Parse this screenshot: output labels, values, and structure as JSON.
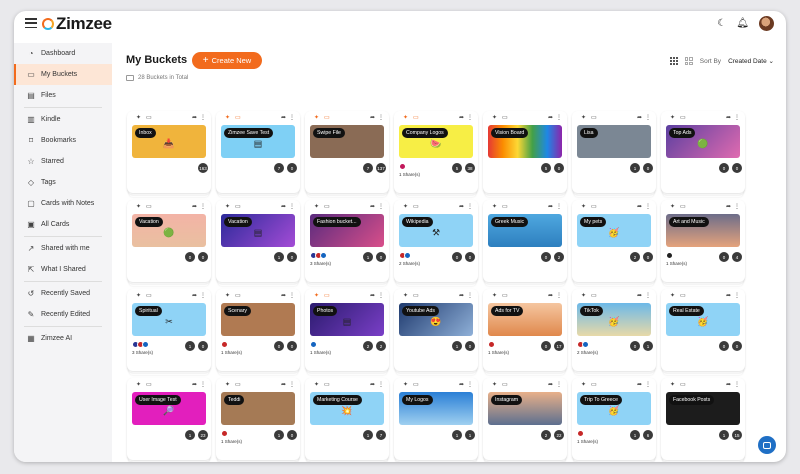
{
  "app": {
    "name": "Zimzee"
  },
  "topbar": {
    "dark_mode_icon": "moon-icon",
    "notifications_icon": "bell-icon"
  },
  "sidebar": {
    "items": [
      {
        "label": "Dashboard",
        "icon": "◔",
        "active": false
      },
      {
        "label": "My Buckets",
        "icon": "▭",
        "active": true
      },
      {
        "label": "Files",
        "icon": "▤",
        "active": false
      },
      {
        "label": "Kindle",
        "icon": "▥",
        "active": false
      },
      {
        "label": "Bookmarks",
        "icon": "⌑",
        "active": false
      },
      {
        "label": "Starred",
        "icon": "☆",
        "active": false
      },
      {
        "label": "Tags",
        "icon": "◇",
        "active": false
      },
      {
        "label": "Cards with Notes",
        "icon": "▢",
        "active": false
      },
      {
        "label": "All Cards",
        "icon": "▣",
        "active": false
      },
      {
        "label": "Shared with me",
        "icon": "↗",
        "active": false
      },
      {
        "label": "What I Shared",
        "icon": "⇱",
        "active": false
      },
      {
        "label": "Recently Saved",
        "icon": "↺",
        "active": false
      },
      {
        "label": "Recently Edited",
        "icon": "✎",
        "active": false
      },
      {
        "label": "Zimzee AI",
        "icon": "▦",
        "active": false
      }
    ]
  },
  "main": {
    "title": "My Buckets",
    "create_label": "Create New",
    "count_text": "28 Buckets in Total",
    "sort_label": "Sort By",
    "sort_value": "Created Date"
  },
  "buckets": [
    {
      "name": "Inbox",
      "bg": "#f0b43c",
      "emoji": "📥",
      "pin": false,
      "shares": "",
      "avatars": [],
      "a": "",
      "b": "163"
    },
    {
      "name": "Zimzee Save Test",
      "bg": "#7fd0f5",
      "emoji": "▤",
      "pin": true,
      "shares": "",
      "avatars": [],
      "a": "7",
      "b": "0"
    },
    {
      "name": "Swipe File",
      "bg": "#8a6b55",
      "emoji": "",
      "pin": true,
      "shares": "",
      "avatars": [],
      "a": "7",
      "b": "137"
    },
    {
      "name": "Company Logos",
      "bg": "#f7ee45",
      "emoji": "🍉",
      "pin": true,
      "shares": "1 Share(s)",
      "avatars": [
        "#c2185b"
      ],
      "a": "5",
      "b": "38"
    },
    {
      "name": "Vision Board",
      "bg": "linear-gradient(90deg,#e53935,#fb8c00,#fdd835,#43a047,#1e88e5,#8e24aa)",
      "emoji": "",
      "pin": false,
      "shares": "",
      "avatars": [],
      "a": "5",
      "b": "0"
    },
    {
      "name": "Lisa",
      "bg": "#7b8794",
      "emoji": "",
      "pin": false,
      "shares": "",
      "avatars": [],
      "a": "1",
      "b": "0"
    },
    {
      "name": "Top Ads",
      "bg": "linear-gradient(135deg,#5b3fa0,#e06bb0)",
      "emoji": "🟢",
      "pin": false,
      "shares": "",
      "avatars": [],
      "a": "0",
      "b": "0"
    },
    {
      "name": "Vacation",
      "bg": "linear-gradient(180deg,#f3b3a6,#e9c0a0)",
      "emoji": "🟢",
      "pin": false,
      "shares": "",
      "avatars": [],
      "a": "0",
      "b": "0"
    },
    {
      "name": "Vacation",
      "bg": "linear-gradient(135deg,#2c2a9a,#a44cd6)",
      "emoji": "▤",
      "pin": false,
      "shares": "",
      "avatars": [],
      "a": "1",
      "b": "0"
    },
    {
      "name": "Fashion bucket...",
      "bg": "linear-gradient(135deg,#5a2b7e,#d94f8a)",
      "emoji": "",
      "pin": false,
      "shares": "3 Share(s)",
      "avatars": [
        "#283593",
        "#c62828",
        "#1565c0"
      ],
      "a": "1",
      "b": "0"
    },
    {
      "name": "Wikipedia",
      "bg": "#8fd3f6",
      "emoji": "⚒",
      "pin": false,
      "shares": "2 Share(s)",
      "avatars": [
        "#c62828",
        "#1565c0"
      ],
      "a": "0",
      "b": "0"
    },
    {
      "name": "Greek Music",
      "bg": "linear-gradient(180deg,#4fa8e0,#2d7fbf)",
      "emoji": "",
      "pin": false,
      "shares": "",
      "avatars": [],
      "a": "0",
      "b": "2"
    },
    {
      "name": "My pets",
      "bg": "#8fd3f6",
      "emoji": "🥳",
      "pin": false,
      "shares": "",
      "avatars": [],
      "a": "2",
      "b": "0"
    },
    {
      "name": "Art and Music",
      "bg": "linear-gradient(180deg,#6d6d8a,#e5a37c)",
      "emoji": "",
      "pin": false,
      "shares": "1 Share(s)",
      "avatars": [
        "#222222"
      ],
      "a": "0",
      "b": "4"
    },
    {
      "name": "Spiritual",
      "bg": "#8fd3f6",
      "emoji": "✂",
      "pin": false,
      "shares": "3 Share(s)",
      "avatars": [
        "#283593",
        "#c62828",
        "#1565c0"
      ],
      "a": "1",
      "b": "0"
    },
    {
      "name": "Scenary",
      "bg": "#b07a52",
      "emoji": "",
      "pin": false,
      "shares": "1 Share(s)",
      "avatars": [
        "#c62828"
      ],
      "a": "0",
      "b": "0"
    },
    {
      "name": "Photos",
      "bg": "linear-gradient(135deg,#2b1b6e,#7a3fc7)",
      "emoji": "▤",
      "pin": true,
      "shares": "1 Share(s)",
      "avatars": [
        "#1565c0"
      ],
      "a": "2",
      "b": "2"
    },
    {
      "name": "Youtube Ads",
      "bg": "linear-gradient(135deg,#1f3a6e,#8fb0d8)",
      "emoji": "😍",
      "pin": false,
      "shares": "",
      "avatars": [],
      "a": "1",
      "b": "0"
    },
    {
      "name": "Ads for TV",
      "bg": "linear-gradient(180deg,#f5c6a0,#e0884c)",
      "emoji": "",
      "pin": false,
      "shares": "1 Share(s)",
      "avatars": [
        "#c62828"
      ],
      "a": "0",
      "b": "17"
    },
    {
      "name": "TikTok",
      "bg": "linear-gradient(180deg,#6cb8e8,#e8d9a8)",
      "emoji": "🥳",
      "pin": false,
      "shares": "2 Share(s)",
      "avatars": [
        "#c62828",
        "#1565c0"
      ],
      "a": "0",
      "b": "1"
    },
    {
      "name": "Real Estate",
      "bg": "#8fd3f6",
      "emoji": "🥳",
      "pin": false,
      "shares": "",
      "avatars": [],
      "a": "0",
      "b": "0"
    },
    {
      "name": "User Image Test",
      "bg": "#e21fbd",
      "emoji": "🔎",
      "pin": false,
      "shares": "",
      "avatars": [],
      "a": "1",
      "b": "23"
    },
    {
      "name": "Teddi",
      "bg": "#a57a55",
      "emoji": "",
      "pin": false,
      "shares": "1 Share(s)",
      "avatars": [
        "#c62828"
      ],
      "a": "1",
      "b": "0"
    },
    {
      "name": "Marketing Course",
      "bg": "#8fd3f6",
      "emoji": "💥",
      "pin": false,
      "shares": "",
      "avatars": [],
      "a": "1",
      "b": "7"
    },
    {
      "name": "My Logos",
      "bg": "linear-gradient(180deg,#2a7fd6,#9fd0f0)",
      "emoji": "",
      "pin": false,
      "shares": "",
      "avatars": [],
      "a": "1",
      "b": "1"
    },
    {
      "name": "Instagram",
      "bg": "linear-gradient(180deg,#e8b089,#5d6f8f)",
      "emoji": "",
      "pin": false,
      "shares": "",
      "avatars": [],
      "a": "2",
      "b": "22"
    },
    {
      "name": "Trip To Greece",
      "bg": "#8fd3f6",
      "emoji": "🥳",
      "pin": false,
      "shares": "1 Share(s)",
      "avatars": [
        "#c62828"
      ],
      "a": "1",
      "b": "6"
    },
    {
      "name": "Facebook Posts",
      "bg": "#1c1c1c",
      "emoji": "",
      "pin": false,
      "shares": "",
      "avatars": [],
      "a": "1",
      "b": "15"
    }
  ]
}
